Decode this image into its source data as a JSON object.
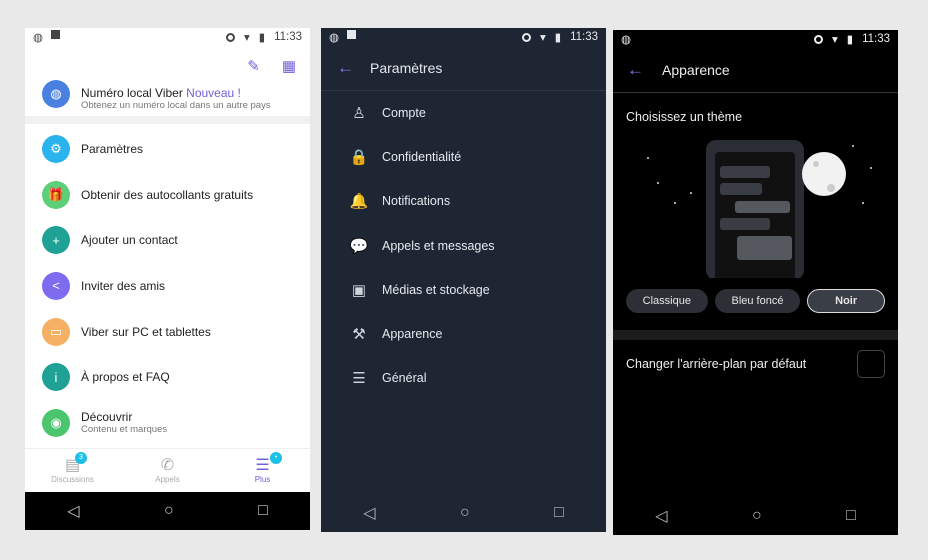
{
  "status": {
    "time": "11:33"
  },
  "left": {
    "header_icons": [
      "pencil-icon",
      "qr-code-icon"
    ],
    "promo": {
      "title": "Numéro local Viber",
      "tag": "Nouveau !",
      "subtitle": "Obtenez un numéro local dans un autre pays",
      "color": "#4a80e0"
    },
    "items": [
      {
        "label": "Paramètres",
        "icon": "gear-icon",
        "color": "#2bb3ee",
        "glyph": "⚙"
      },
      {
        "label": "Obtenir des autocollants gratuits",
        "icon": "gift-icon",
        "color": "#5ccf78",
        "glyph": "🎁"
      },
      {
        "label": "Ajouter un contact",
        "icon": "add-contact-icon",
        "color": "#1fa195",
        "glyph": "+"
      },
      {
        "label": "Inviter des amis",
        "icon": "share-icon",
        "color": "#7d6cf0",
        "glyph": "<"
      },
      {
        "label": "Viber sur PC et tablettes",
        "icon": "desktop-icon",
        "color": "#f4b063",
        "glyph": "▭"
      },
      {
        "label": "À propos et FAQ",
        "icon": "info-icon",
        "color": "#1fa195",
        "glyph": "i"
      },
      {
        "label": "Découvrir",
        "subtitle": "Contenu et marques",
        "icon": "compass-icon",
        "color": "#4cc66e",
        "glyph": "◉"
      }
    ],
    "tabs": [
      {
        "label": "Discussions",
        "badge": "3"
      },
      {
        "label": "Appels"
      },
      {
        "label": "Plus",
        "badge": "•"
      }
    ],
    "accent": "#7360d8"
  },
  "middle": {
    "title": "Paramètres",
    "items": [
      {
        "label": "Compte",
        "icon": "person-icon",
        "glyph": "♙"
      },
      {
        "label": "Confidentialité",
        "icon": "lock-icon",
        "glyph": "🔒"
      },
      {
        "label": "Notifications",
        "icon": "bell-icon",
        "glyph": "🔔"
      },
      {
        "label": "Appels et messages",
        "icon": "chat-bubble-icon",
        "glyph": "💬"
      },
      {
        "label": "Médias et stockage",
        "icon": "image-icon",
        "glyph": "▣"
      },
      {
        "label": "Apparence",
        "icon": "brush-icon",
        "glyph": "⚒"
      },
      {
        "label": "Général",
        "icon": "list-icon",
        "glyph": "☰"
      }
    ]
  },
  "right": {
    "title": "Apparence",
    "section": "Choisissez un thème",
    "themes": [
      {
        "label": "Classique"
      },
      {
        "label": "Bleu foncé"
      },
      {
        "label": "Noir",
        "selected": true
      }
    ],
    "setting": "Changer l'arrière-plan par défaut",
    "checkbox_checked": false
  }
}
